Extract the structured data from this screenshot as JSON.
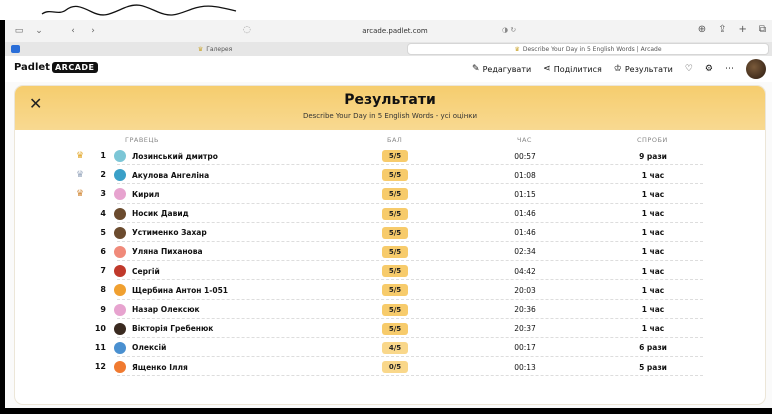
{
  "browser": {
    "url": "arcade.padlet.com",
    "tabs": [
      {
        "label": "Галерея",
        "active": false
      },
      {
        "label": "Describe Your Day in 5 English Words | Arcade",
        "active": true
      }
    ]
  },
  "header": {
    "brand_name": "Padlet",
    "brand_badge": "ARCADE",
    "actions": [
      {
        "name": "edit-button",
        "icon": "pencil-icon",
        "glyph": "✎",
        "label": "Редагувати"
      },
      {
        "name": "share-button",
        "icon": "share-icon",
        "glyph": "⋖",
        "label": "Поділитися"
      },
      {
        "name": "results-button",
        "icon": "trophy-icon",
        "glyph": "♔",
        "label": "Результати"
      }
    ]
  },
  "results": {
    "title": "Результати",
    "subtitle": "Describe Your Day in 5 English Words - усі оцінки",
    "columns": {
      "player": "ГРАВЕЦЬ",
      "score": "БАЛ",
      "time": "ЧАС",
      "attempts": "СПРОБИ"
    },
    "colors": {
      "score_full": "#f7cb6b",
      "score_partial": "#f9d78a",
      "crown_gold": "#e2a72a",
      "crown_silver": "#9aa9bf",
      "crown_bronze": "#d28a3a"
    },
    "rows": [
      {
        "rank": "1",
        "crown": "gold",
        "avatar": "#7cc6d6",
        "name": "Лозинський дмитро",
        "score": "5/5",
        "time": "00:57",
        "attempts": "9 рази"
      },
      {
        "rank": "2",
        "crown": "silver",
        "avatar": "#3aa0c8",
        "name": "Акулова Ангеліна",
        "score": "5/5",
        "time": "01:08",
        "attempts": "1 час"
      },
      {
        "rank": "3",
        "crown": "bronze",
        "avatar": "#e7a3cf",
        "name": "Кирил",
        "score": "5/5",
        "time": "01:15",
        "attempts": "1 час"
      },
      {
        "rank": "4",
        "crown": "",
        "avatar": "#6b4b2e",
        "name": "Носик Давид",
        "score": "5/5",
        "time": "01:46",
        "attempts": "1 час"
      },
      {
        "rank": "5",
        "crown": "",
        "avatar": "#6b4b2e",
        "name": "Устименко Захар",
        "score": "5/5",
        "time": "01:46",
        "attempts": "1 час"
      },
      {
        "rank": "6",
        "crown": "",
        "avatar": "#f08a7a",
        "name": "Уляна Пиханова",
        "score": "5/5",
        "time": "02:34",
        "attempts": "1 час"
      },
      {
        "rank": "7",
        "crown": "",
        "avatar": "#c0392b",
        "name": "Сергій",
        "score": "5/5",
        "time": "04:42",
        "attempts": "1 час"
      },
      {
        "rank": "8",
        "crown": "",
        "avatar": "#f0a030",
        "name": "Щербина Антон 1-051",
        "score": "5/5",
        "time": "20:03",
        "attempts": "1 час"
      },
      {
        "rank": "9",
        "crown": "",
        "avatar": "#e7a3cf",
        "name": "Назар Олексюк",
        "score": "5/5",
        "time": "20:36",
        "attempts": "1 час"
      },
      {
        "rank": "10",
        "crown": "",
        "avatar": "#3a2a20",
        "name": "Вікторія Гребенюк",
        "score": "5/5",
        "time": "20:37",
        "attempts": "1 час"
      },
      {
        "rank": "11",
        "crown": "",
        "avatar": "#4a90d0",
        "name": "Олексій",
        "score": "4/5",
        "time": "00:17",
        "attempts": "6 рази"
      },
      {
        "rank": "12",
        "crown": "",
        "avatar": "#f07a30",
        "name": "Ященко Ілля",
        "score": "0/5",
        "time": "00:13",
        "attempts": "5 рази"
      }
    ]
  }
}
